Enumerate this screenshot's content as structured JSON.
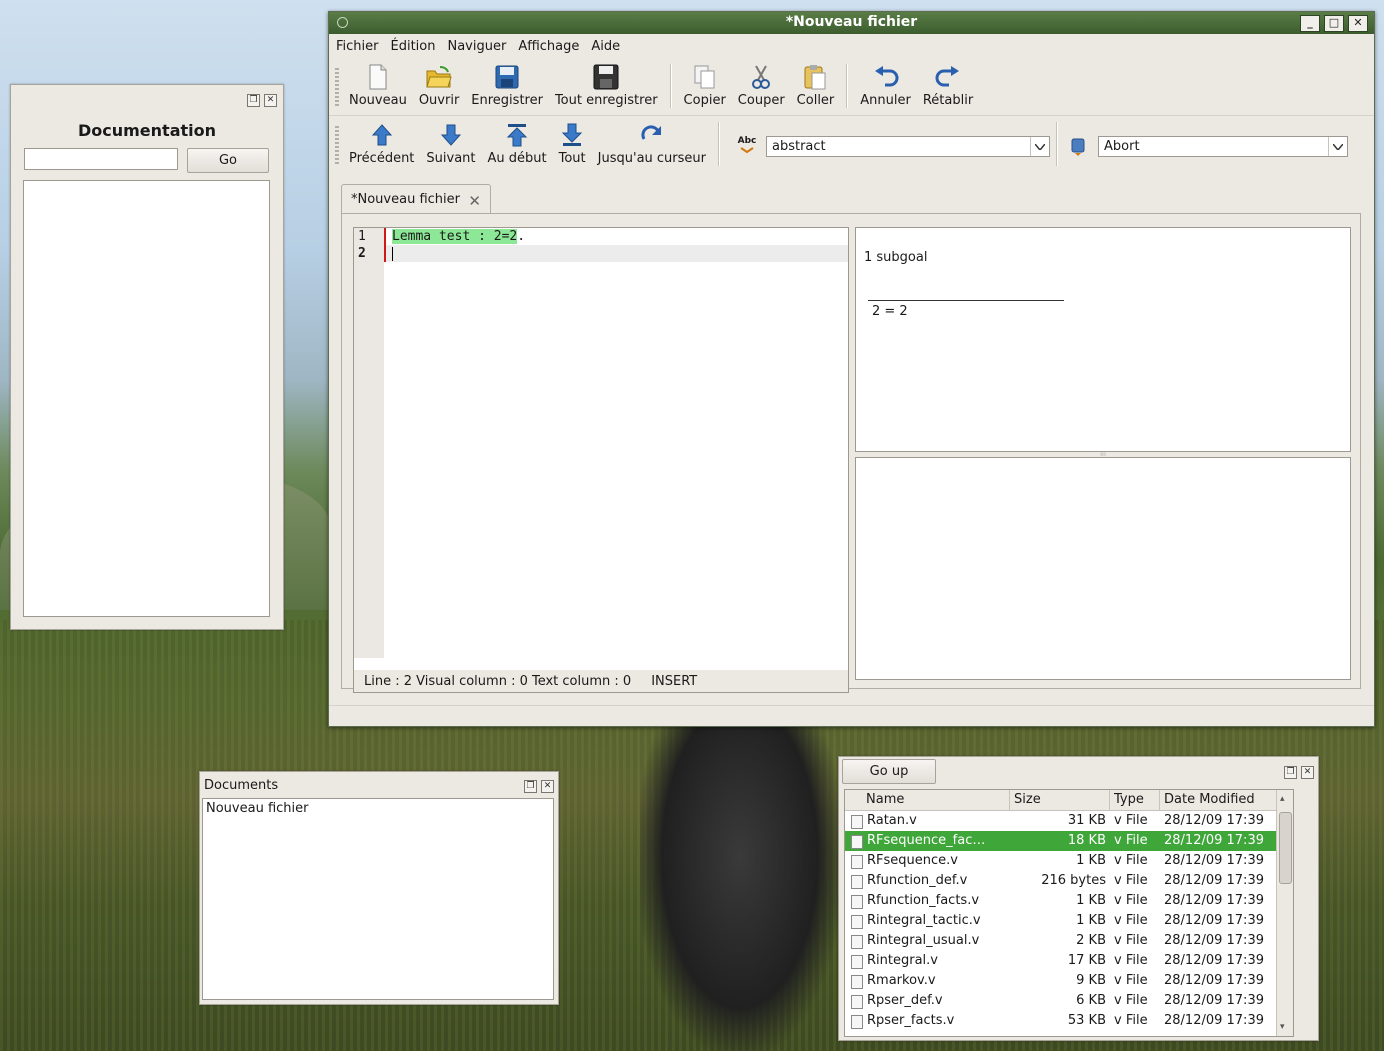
{
  "window": {
    "title": "*Nouveau fichier"
  },
  "menu": [
    "Fichier",
    "Édition",
    "Naviguer",
    "Affichage",
    "Aide"
  ],
  "toolbar1": [
    {
      "label": "Nouveau",
      "icon": "new-file-icon"
    },
    {
      "label": "Ouvrir",
      "icon": "open-folder-icon"
    },
    {
      "label": "Enregistrer",
      "icon": "save-icon"
    },
    {
      "label": "Tout enregistrer",
      "icon": "save-all-icon"
    },
    {
      "label": "Copier",
      "icon": "copy-icon"
    },
    {
      "label": "Couper",
      "icon": "cut-icon"
    },
    {
      "label": "Coller",
      "icon": "paste-icon"
    },
    {
      "label": "Annuler",
      "icon": "undo-icon"
    },
    {
      "label": "Rétablir",
      "icon": "redo-icon"
    }
  ],
  "toolbar2": [
    {
      "label": "Précédent",
      "icon": "up-arrow-icon"
    },
    {
      "label": "Suivant",
      "icon": "down-arrow-icon"
    },
    {
      "label": "Au début",
      "icon": "to-start-icon"
    },
    {
      "label": "Tout",
      "icon": "to-end-icon"
    },
    {
      "label": "Jusqu'au curseur",
      "icon": "to-cursor-icon"
    }
  ],
  "combos": {
    "tactic": "abstract",
    "command": "Abort",
    "abc_label": "Abc"
  },
  "tab": {
    "label": "*Nouveau fichier"
  },
  "editor": {
    "line_numbers": [
      "1",
      "2"
    ],
    "code_processed": "Lemma test : 2=2",
    "code_rest": ".",
    "status": {
      "position": "Line : 2 Visual column : 0 Text column : 0",
      "mode": "INSERT"
    }
  },
  "goals": {
    "count": "1 subgoal",
    "goal": "2 = 2"
  },
  "documentation": {
    "title": "Documentation",
    "search_value": "",
    "go_label": "Go"
  },
  "documents": {
    "title": "Documents",
    "items": [
      "Nouveau fichier"
    ]
  },
  "filebrowser": {
    "go_up_label": "Go up",
    "columns": [
      "Name",
      "Size",
      "Type",
      "Date Modified"
    ],
    "rows": [
      {
        "name": "Ratan.v",
        "size": "31 KB",
        "type": "v File",
        "date": "28/12/09 17:39"
      },
      {
        "name": "RFsequence_fac…",
        "size": "18 KB",
        "type": "v File",
        "date": "28/12/09 17:39"
      },
      {
        "name": "RFsequence.v",
        "size": "1 KB",
        "type": "v File",
        "date": "28/12/09 17:39"
      },
      {
        "name": "Rfunction_def.v",
        "size": "216 bytes",
        "type": "v File",
        "date": "28/12/09 17:39"
      },
      {
        "name": "Rfunction_facts.v",
        "size": "1 KB",
        "type": "v File",
        "date": "28/12/09 17:39"
      },
      {
        "name": "Rintegral_tactic.v",
        "size": "1 KB",
        "type": "v File",
        "date": "28/12/09 17:39"
      },
      {
        "name": "Rintegral_usual.v",
        "size": "2 KB",
        "type": "v File",
        "date": "28/12/09 17:39"
      },
      {
        "name": "Rintegral.v",
        "size": "17 KB",
        "type": "v File",
        "date": "28/12/09 17:39"
      },
      {
        "name": "Rmarkov.v",
        "size": "9 KB",
        "type": "v File",
        "date": "28/12/09 17:39"
      },
      {
        "name": "Rpser_def.v",
        "size": "6 KB",
        "type": "v File",
        "date": "28/12/09 17:39"
      },
      {
        "name": "Rpser_facts.v",
        "size": "53 KB",
        "type": "v File",
        "date": "28/12/09 17:39"
      }
    ],
    "selected_index": 1
  },
  "colors": {
    "titlebar": "#4a6d3a",
    "selection": "#3fa63a",
    "processed": "#8ce896",
    "marker": "#d01818"
  }
}
